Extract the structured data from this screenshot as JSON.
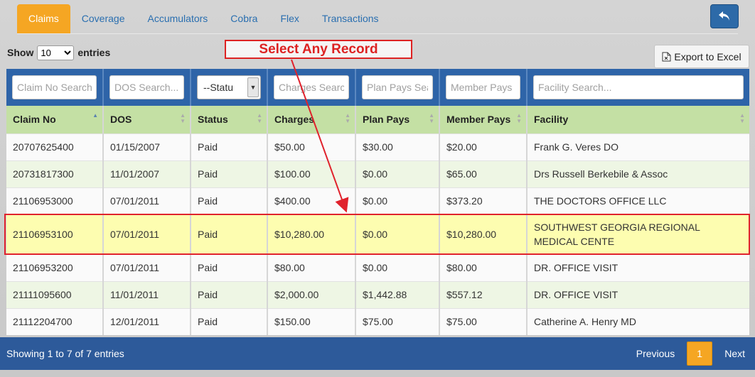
{
  "tabs": [
    {
      "label": "Claims",
      "active": true
    },
    {
      "label": "Coverage",
      "active": false
    },
    {
      "label": "Accumulators",
      "active": false
    },
    {
      "label": "Cobra",
      "active": false
    },
    {
      "label": "Flex",
      "active": false
    },
    {
      "label": "Transactions",
      "active": false
    }
  ],
  "back_button_icon": "undo-arrow-icon",
  "length_menu": {
    "show_label": "Show",
    "selected": "10",
    "entries_label": "entries"
  },
  "export_label": "Export to Excel",
  "callout_text": "Select Any Record",
  "filters": {
    "claim_no": "Claim No Search",
    "dos": "DOS Search...",
    "status": "--Statu",
    "charges": "Charges Search",
    "plan_pays": "Plan Pays Search",
    "member_pays": "Member Pays",
    "facility": "Facility Search..."
  },
  "columns": [
    "Claim No",
    "DOS",
    "Status",
    "Charges",
    "Plan Pays",
    "Member Pays",
    "Facility"
  ],
  "rows": [
    {
      "claim_no": "20707625400",
      "dos": "01/15/2007",
      "status": "Paid",
      "charges": "$50.00",
      "plan_pays": "$30.00",
      "member_pays": "$20.00",
      "facility": "Frank G. Veres DO"
    },
    {
      "claim_no": "20731817300",
      "dos": "11/01/2007",
      "status": "Paid",
      "charges": "$100.00",
      "plan_pays": "$0.00",
      "member_pays": "$65.00",
      "facility": "Drs Russell Berkebile & Assoc"
    },
    {
      "claim_no": "21106953000",
      "dos": "07/01/2011",
      "status": "Paid",
      "charges": "$400.00",
      "plan_pays": "$0.00",
      "member_pays": "$373.20",
      "facility": "THE DOCTORS OFFICE LLC"
    },
    {
      "claim_no": "21106953100",
      "dos": "07/01/2011",
      "status": "Paid",
      "charges": "$10,280.00",
      "plan_pays": "$0.00",
      "member_pays": "$10,280.00",
      "facility": "SOUTHWEST GEORGIA REGIONAL MEDICAL CENTE",
      "selected": true
    },
    {
      "claim_no": "21106953200",
      "dos": "07/01/2011",
      "status": "Paid",
      "charges": "$80.00",
      "plan_pays": "$0.00",
      "member_pays": "$80.00",
      "facility": "DR. OFFICE VISIT"
    },
    {
      "claim_no": "21111095600",
      "dos": "11/01/2011",
      "status": "Paid",
      "charges": "$2,000.00",
      "plan_pays": "$1,442.88",
      "member_pays": "$557.12",
      "facility": "DR. OFFICE VISIT"
    },
    {
      "claim_no": "21112204700",
      "dos": "12/01/2011",
      "status": "Paid",
      "charges": "$150.00",
      "plan_pays": "$75.00",
      "member_pays": "$75.00",
      "facility": "Catherine A. Henry MD"
    }
  ],
  "footer": {
    "info": "Showing 1 to 7 of 7 entries",
    "previous": "Previous",
    "current_page": "1",
    "next": "Next"
  },
  "colors": {
    "active_tab": "#f5a623",
    "header_bar": "#2e64a8",
    "column_header": "#c4e0a4",
    "selected_row": "#fdfdb0",
    "highlight": "#e0222c"
  }
}
